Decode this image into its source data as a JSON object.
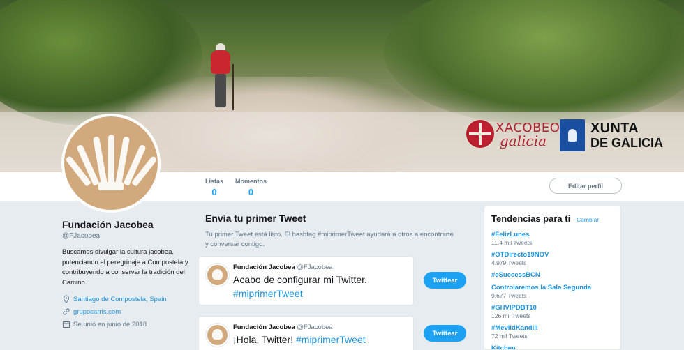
{
  "banner": {
    "xacobeo_line1": "XACOBEO",
    "xacobeo_line2": "galicia",
    "xunta_line1": "XUNTA",
    "xunta_line2": "DE GALICIA"
  },
  "navbar": {
    "stats": [
      {
        "label": "Listas",
        "value": "0"
      },
      {
        "label": "Momentos",
        "value": "0"
      }
    ],
    "edit_profile": "Editar perfil"
  },
  "profile": {
    "name": "Fundación Jacobea",
    "handle": "@FJacobea",
    "bio": "Buscamos divulgar la cultura jacobea, potenciando el peregrinaje a Compostela y contribuyendo a conservar la tradición del Camino.",
    "location": "Santiago de Compostela, Spain",
    "website": "grupocarris.com",
    "joined": "Se unió en junio de 2018",
    "icons": {
      "location": "location-pin-icon",
      "website": "link-icon",
      "joined": "calendar-icon"
    }
  },
  "first_tweet": {
    "heading": "Envía tu primer Tweet",
    "subtitle": "Tu primer Tweet está listo. El hashtag #miprimerTweet ayudará a otros a encontrarte y conversar contigo.",
    "suggestions": [
      {
        "name": "Fundación Jacobea",
        "handle": "@FJacobea",
        "text": "Acabo de configurar mi Twitter.",
        "hashtag": "#miprimerTweet",
        "button": "Twittear"
      },
      {
        "name": "Fundación Jacobea",
        "handle": "@FJacobea",
        "text": "¡Hola, Twitter!",
        "hashtag": "#miprimerTweet",
        "button": "Twittear"
      }
    ]
  },
  "trends": {
    "title": "Tendencias para ti",
    "change": "· Cambiar",
    "items": [
      {
        "name": "#FelizLunes",
        "count": "11,4 mil Tweets"
      },
      {
        "name": "#OTDirecto19NOV",
        "count": "4.979 Tweets"
      },
      {
        "name": "#eSuccessBCN",
        "count": ""
      },
      {
        "name": "Controlaremos la Sala Segunda",
        "count": "9.677 Tweets"
      },
      {
        "name": "#GHVIPDBT10",
        "count": "126 mil Tweets"
      },
      {
        "name": "#MevlidKandili",
        "count": "72 mil Tweets"
      },
      {
        "name": "Kitchen",
        "count": ""
      }
    ]
  },
  "colors": {
    "accent": "#1da1f2",
    "link": "#1b95e0",
    "avatar": "#d2a97c"
  }
}
